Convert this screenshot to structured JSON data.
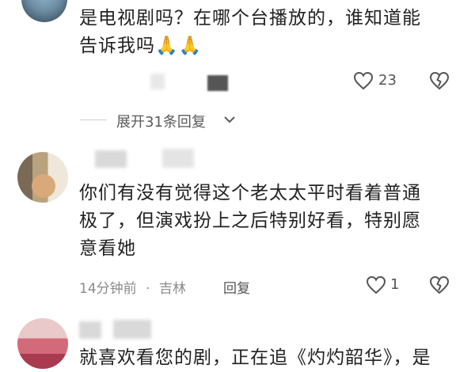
{
  "comment1": {
    "text_line1": "是电视剧吗？在哪个台播放的，谁知道能",
    "text_line2": "告诉我吗",
    "emoji": "🙏🙏",
    "like_count": "23"
  },
  "replies": {
    "expand_label": "展开31条回复"
  },
  "comment2": {
    "text_line1": "你们有没有觉得这个老太太平时看着普通",
    "text_line2": "极了，但演戏扮上之后特别好看，特别愿",
    "text_line3": "意看她",
    "time": "14分钟前",
    "separator": "·",
    "location": "吉林",
    "reply_label": "回复",
    "like_count": "1"
  },
  "comment3": {
    "text_partial": "就喜欢看您的剧，正在追《灼灼韶华》，是"
  },
  "icons": {
    "like": "heart-outline-icon",
    "dislike": "broken-heart-icon",
    "expand": "chevron-down-icon"
  },
  "colors": {
    "text": "#222222",
    "meta": "#8a8a8a",
    "emoji": "#f2b233"
  }
}
